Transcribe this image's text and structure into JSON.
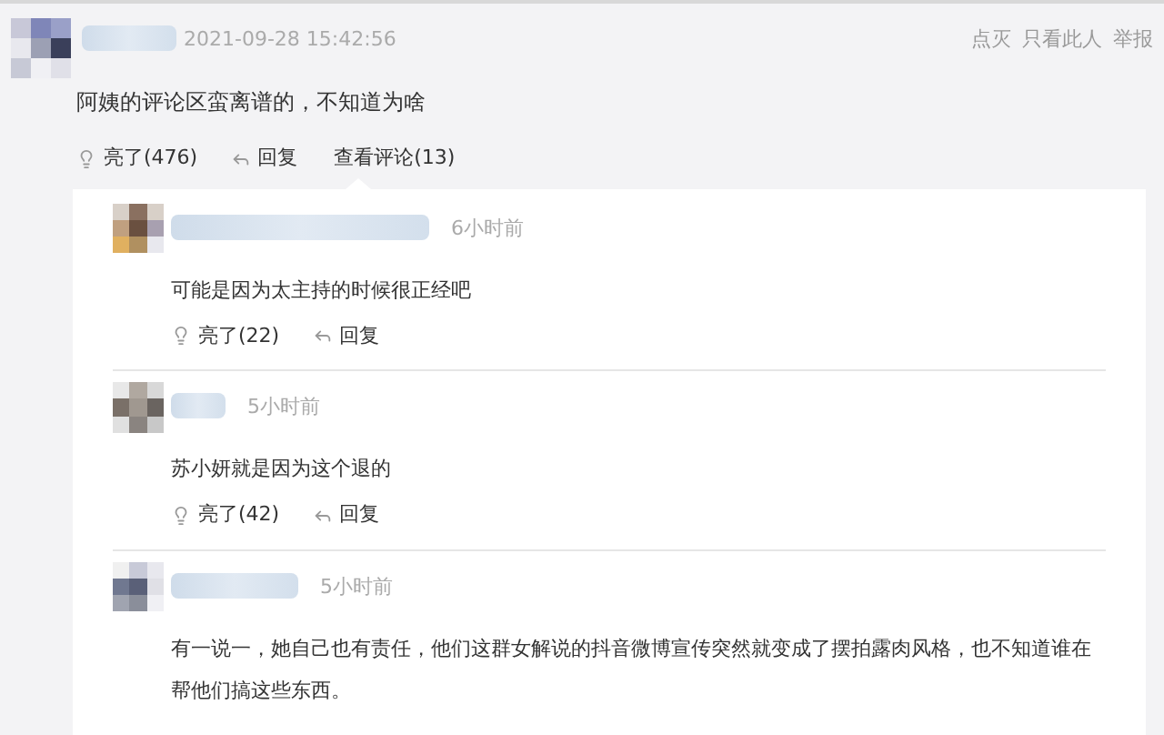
{
  "post": {
    "time": "2021-09-28 15:42:56",
    "header_links": [
      "点灭",
      "只看此人",
      "举报"
    ],
    "text": "阿姨的评论区蛮离谱的，不知道为啥",
    "like": "亮了(476)",
    "reply": "回复",
    "view_comments": "查看评论(13)"
  },
  "replies": [
    {
      "time": "6小时前",
      "text": "可能是因为太主持的时候很正经吧",
      "like": "亮了(22)",
      "reply": "回复"
    },
    {
      "time": "5小时前",
      "text": "苏小妍就是因为这个退的",
      "like": "亮了(42)",
      "reply": "回复"
    },
    {
      "time": "5小时前",
      "text": "有一说一，她自己也有责任，他们这群女解说的抖音微博宣传突然就变成了摆拍露肉风格，也不知道谁在帮他们搞这些东西。"
    }
  ]
}
